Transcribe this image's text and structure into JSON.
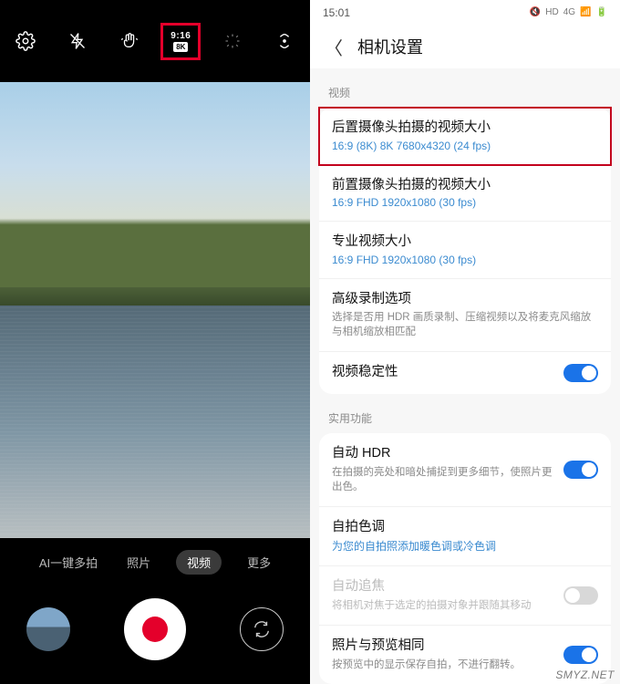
{
  "left": {
    "ratio_top": "9:16",
    "ratio_badge": "8K",
    "modes": {
      "ai": "AI一键多拍",
      "photo": "照片",
      "video": "视频",
      "more": "更多"
    }
  },
  "right": {
    "status_time": "15:01",
    "status_net": "4G",
    "title": "相机设置",
    "section_video": "视频",
    "section_util": "实用功能",
    "rows": {
      "rear": {
        "t": "后置摄像头拍摄的视频大小",
        "s": "16:9 (8K) 8K 7680x4320 (24 fps)"
      },
      "front": {
        "t": "前置摄像头拍摄的视频大小",
        "s": "16:9 FHD 1920x1080 (30 fps)"
      },
      "pro": {
        "t": "专业视频大小",
        "s": "16:9 FHD 1920x1080 (30 fps)"
      },
      "adv": {
        "t": "高级录制选项",
        "d": "选择是否用 HDR 画质录制、压缩视频以及将麦克风缩放与相机缩放相匹配"
      },
      "stab": {
        "t": "视频稳定性"
      },
      "hdr": {
        "t": "自动 HDR",
        "d": "在拍摄的亮处和暗处捕捉到更多细节，使照片更出色。"
      },
      "selfie": {
        "t": "自拍色调",
        "s": "为您的自拍照添加暖色调或冷色调"
      },
      "af": {
        "t": "自动追焦",
        "d": "将相机对焦于选定的拍摄对象并跟随其移动"
      },
      "preview": {
        "t": "照片与预览相同",
        "d": "按预览中的显示保存自拍，不进行翻转。"
      }
    }
  },
  "watermark": "SMYZ.NET"
}
